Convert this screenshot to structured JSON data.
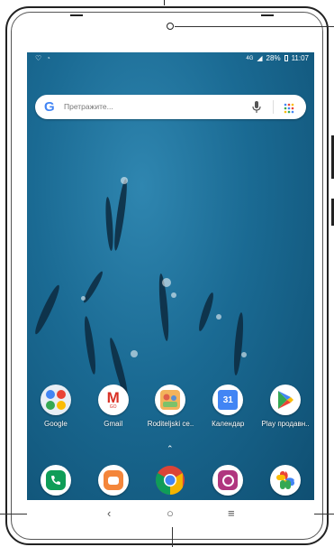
{
  "status_bar": {
    "left_icons": [
      "heart-icon",
      "wifi-icon"
    ],
    "network": "4G",
    "battery": "28%",
    "time": "11:07"
  },
  "search": {
    "logo": "G",
    "placeholder": "Претражите..."
  },
  "apps": [
    {
      "label": "Google",
      "icon": "google-folder-icon"
    },
    {
      "label": "Gmail",
      "icon": "gmail-icon"
    },
    {
      "label": "Roditeljski ce..",
      "icon": "parental-center-icon"
    },
    {
      "label": "Календар",
      "icon": "calendar-icon",
      "badge": "31"
    },
    {
      "label": "Play продавн..",
      "icon": "play-store-icon"
    }
  ],
  "dock": [
    {
      "icon": "phone-icon"
    },
    {
      "icon": "messages-icon"
    },
    {
      "icon": "chrome-icon"
    },
    {
      "icon": "camera-icon"
    },
    {
      "icon": "photos-icon"
    }
  ],
  "navigation": {
    "back": "‹",
    "home": "○",
    "recents": "≡"
  },
  "colors": {
    "ocean": "#1a6a93",
    "gmail_red": "#d93025",
    "google_blue": "#4285f4",
    "phone_green": "#0f9d58",
    "messages_orange": "#f4863b",
    "camera_purple": "#b0367f"
  },
  "gmail_glyph": "M",
  "gmail_sub": "GO"
}
